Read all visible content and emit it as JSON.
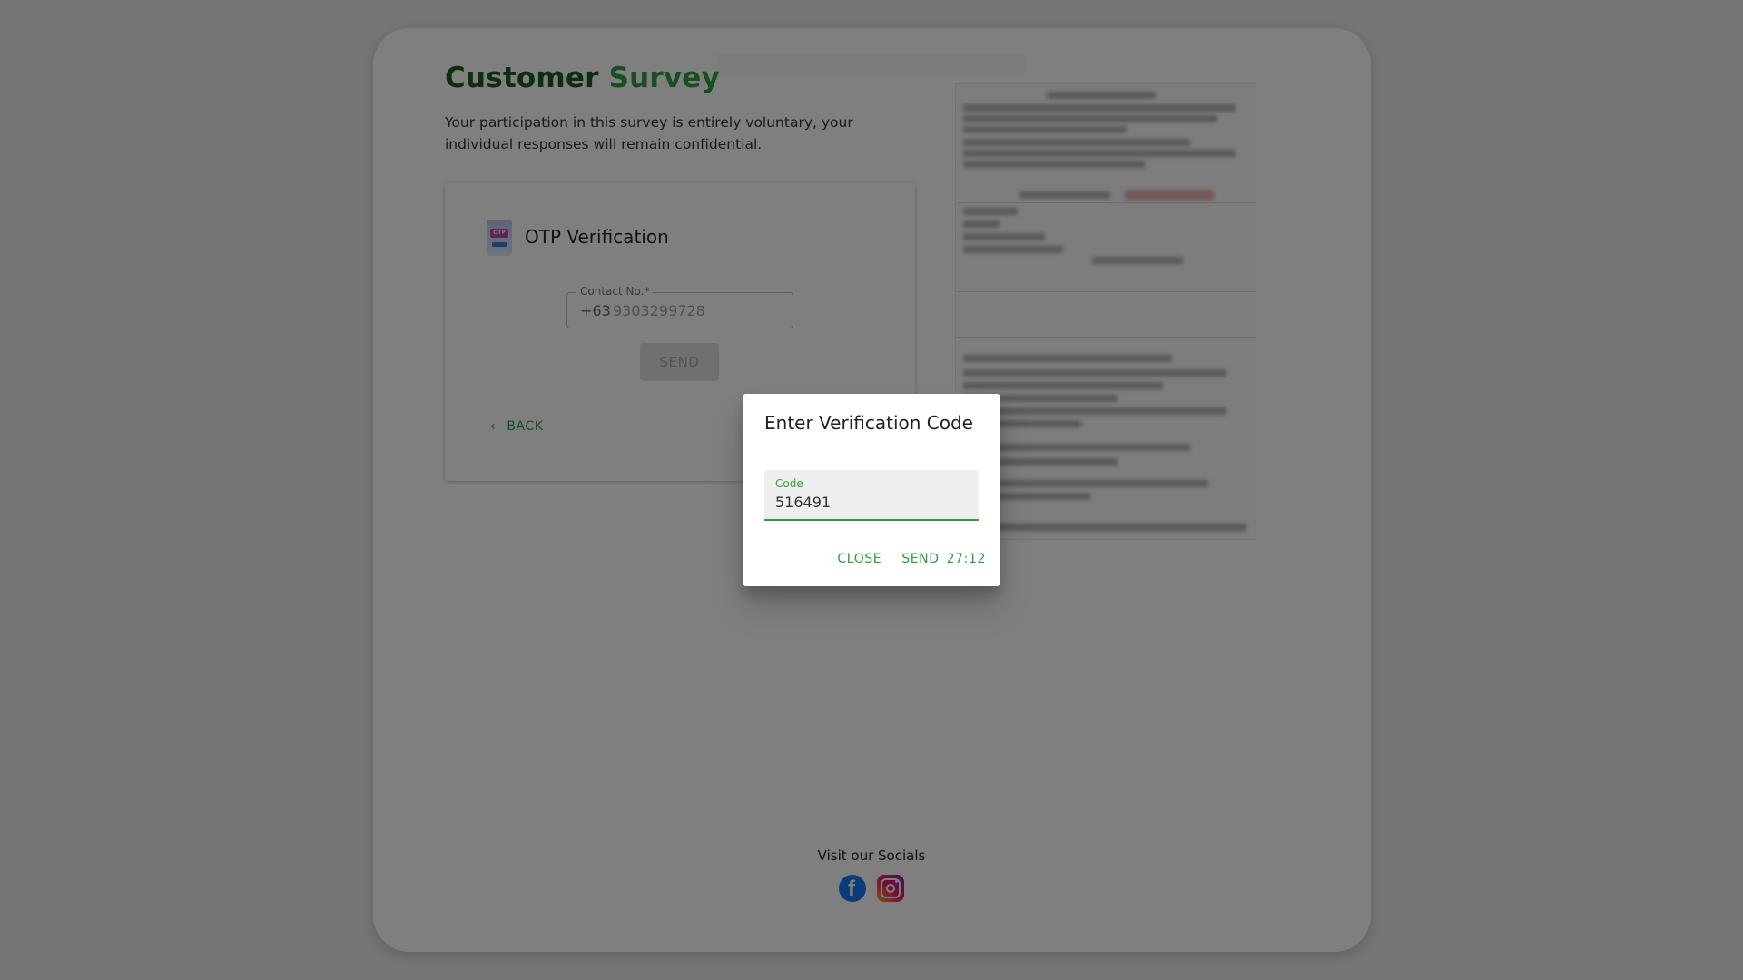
{
  "page": {
    "title_part1": "Customer",
    "title_part2": "Survey",
    "subtitle": "Your participation in this survey is entirely voluntary, your individual responses will remain confidential."
  },
  "otp_card": {
    "icon": "otp-icon",
    "icon_text": "OTP",
    "title": "OTP Verification",
    "contact_label": "Contact No.*",
    "country_code": "+63",
    "contact_value": "9303299728",
    "send_label": "SEND",
    "back_label": "BACK",
    "back_icon": "chevron-left-icon"
  },
  "footer": {
    "socials_label": "Visit our Socials",
    "icons": [
      "facebook-icon",
      "instagram-icon"
    ]
  },
  "dialog": {
    "title": "Enter Verification Code",
    "code_label": "Code",
    "code_value": "516491",
    "close_label": "CLOSE",
    "send_label": "SEND",
    "timer": "27:12"
  },
  "colors": {
    "title_dark": "#1b5e20",
    "accent": "#2e9e3e",
    "facebook": "#1877f2"
  }
}
